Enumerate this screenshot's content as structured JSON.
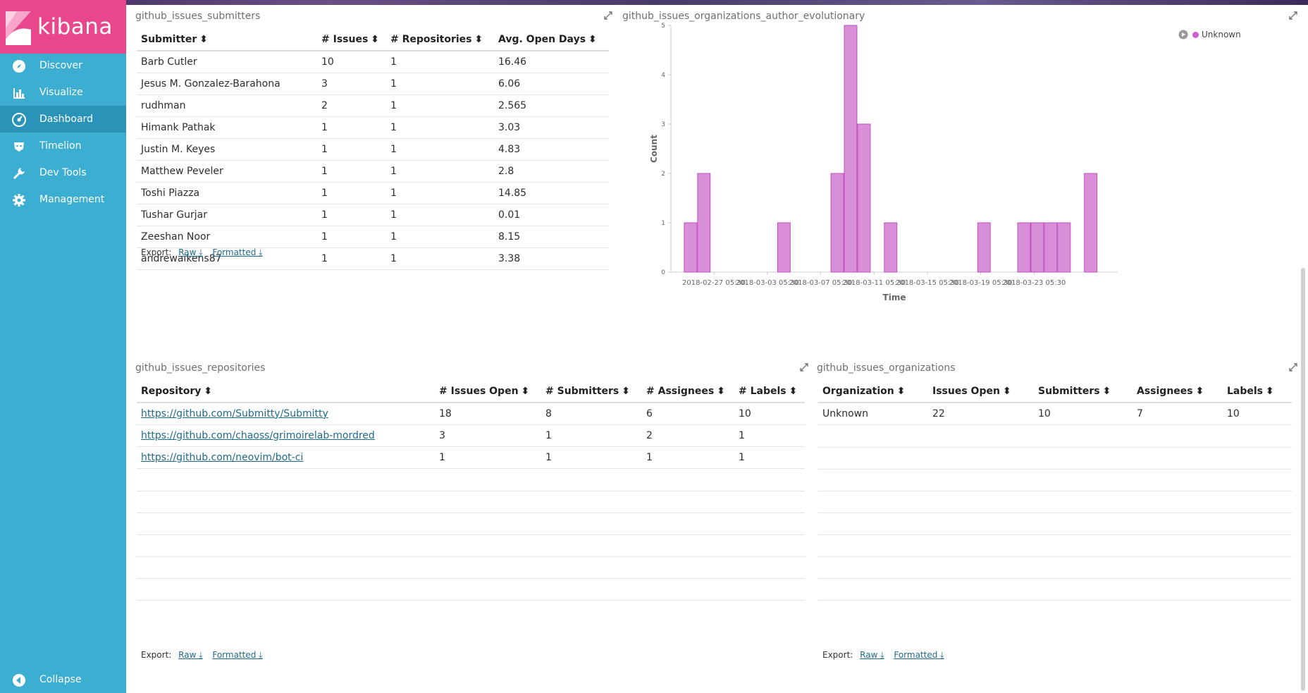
{
  "app": {
    "logo_text": "kibana"
  },
  "sidebar": {
    "items": [
      {
        "label": "Discover",
        "icon": "compass-icon"
      },
      {
        "label": "Visualize",
        "icon": "bar-chart-icon"
      },
      {
        "label": "Dashboard",
        "icon": "dashboard-icon",
        "active": true
      },
      {
        "label": "Timelion",
        "icon": "timelion-icon"
      },
      {
        "label": "Dev Tools",
        "icon": "wrench-icon"
      },
      {
        "label": "Management",
        "icon": "gear-icon"
      }
    ],
    "collapse_label": "Collapse"
  },
  "panels": {
    "submitters": {
      "title": "github_issues_submitters",
      "headers": [
        "Submitter",
        "# Issues",
        "# Repositories",
        "Avg. Open Days"
      ],
      "rows": [
        [
          "Barb Cutler",
          "10",
          "1",
          "16.46"
        ],
        [
          "Jesus M. Gonzalez-Barahona",
          "3",
          "1",
          "6.06"
        ],
        [
          "rudhman",
          "2",
          "1",
          "2.565"
        ],
        [
          "Himank Pathak",
          "1",
          "1",
          "3.03"
        ],
        [
          "Justin M. Keyes",
          "1",
          "1",
          "4.83"
        ],
        [
          "Matthew Peveler",
          "1",
          "1",
          "2.8"
        ],
        [
          "Toshi Piazza",
          "1",
          "1",
          "14.85"
        ],
        [
          "Tushar Gurjar",
          "1",
          "1",
          "0.01"
        ],
        [
          "Zeeshan Noor",
          "1",
          "1",
          "8.15"
        ],
        [
          "andrewaikens87",
          "1",
          "1",
          "3.38"
        ]
      ],
      "export": {
        "label": "Export:",
        "raw": "Raw",
        "formatted": "Formatted"
      }
    },
    "evolutionary": {
      "title": "github_issues_organizations_author_evolutionary",
      "legend": "Unknown"
    },
    "repositories": {
      "title": "github_issues_repositories",
      "headers": [
        "Repository",
        "# Issues Open",
        "# Submitters",
        "# Assignees",
        "# Labels"
      ],
      "rows": [
        [
          "https://github.com/Submitty/Submitty",
          "18",
          "8",
          "6",
          "10"
        ],
        [
          "https://github.com/chaoss/grimoirelab-mordred",
          "3",
          "1",
          "2",
          "1"
        ],
        [
          "https://github.com/neovim/bot-ci",
          "1",
          "1",
          "1",
          "1"
        ]
      ],
      "export": {
        "label": "Export:",
        "raw": "Raw",
        "formatted": "Formatted"
      }
    },
    "organizations": {
      "title": "github_issues_organizations",
      "headers": [
        "Organization",
        "Issues Open",
        "Submitters",
        "Assignees",
        "Labels"
      ],
      "rows": [
        [
          "Unknown",
          "22",
          "10",
          "7",
          "10"
        ]
      ],
      "export": {
        "label": "Export:",
        "raw": "Raw",
        "formatted": "Formatted"
      }
    }
  },
  "chart_data": {
    "type": "bar",
    "title": "",
    "xlabel": "Time",
    "ylabel": "Count",
    "ylim": [
      0,
      5
    ],
    "yticks": [
      0,
      1,
      2,
      3,
      4,
      5
    ],
    "xtick_labels": [
      "2018-02-27 05:30",
      "2018-03-03 05:30",
      "2018-03-07 05:30",
      "2018-03-11 05:30",
      "2018-03-15 05:30",
      "2018-03-19 05:30",
      "2018-03-23 05:30"
    ],
    "series": [
      {
        "name": "Unknown",
        "color": "#d88fd8",
        "points": [
          {
            "date": "2018-02-25",
            "value": 1
          },
          {
            "date": "2018-02-26",
            "value": 2
          },
          {
            "date": "2018-03-04",
            "value": 1
          },
          {
            "date": "2018-03-08",
            "value": 2
          },
          {
            "date": "2018-03-09",
            "value": 5
          },
          {
            "date": "2018-03-10",
            "value": 3
          },
          {
            "date": "2018-03-12",
            "value": 1
          },
          {
            "date": "2018-03-19",
            "value": 1
          },
          {
            "date": "2018-03-22",
            "value": 1
          },
          {
            "date": "2018-03-23",
            "value": 1
          },
          {
            "date": "2018-03-24",
            "value": 1
          },
          {
            "date": "2018-03-25",
            "value": 1
          },
          {
            "date": "2018-03-27",
            "value": 2
          }
        ]
      }
    ]
  }
}
